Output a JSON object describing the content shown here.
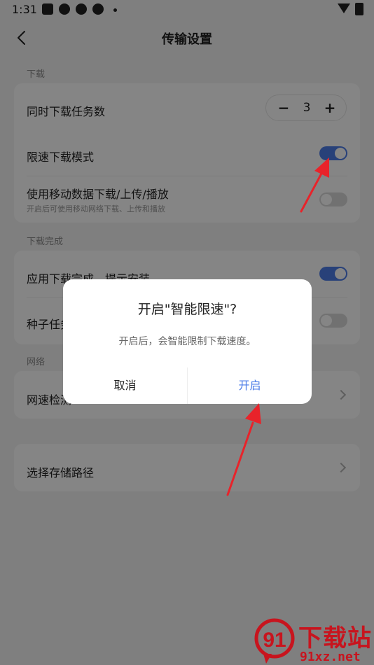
{
  "status_bar": {
    "time": "1:31"
  },
  "header": {
    "title": "传输设置"
  },
  "download_section": {
    "label": "下载",
    "concurrent_label": "同时下载任务数",
    "concurrent_value": "3",
    "minus_label": "−",
    "plus_label": "+",
    "speed_limit_label": "限速下载模式",
    "speed_limit_on": true,
    "mobile_data_label": "使用移动数据下载/上传/播放",
    "mobile_data_sub": "开启后可使用移动网络下载、上传和播放",
    "mobile_data_on": false
  },
  "complete_section": {
    "label": "下载完成",
    "install_label": "应用下载完成，提示安装",
    "install_on": true,
    "seed_label": "种子任务",
    "seed_on": false
  },
  "network_section": {
    "label": "网络",
    "speed_test_label": "网速检测"
  },
  "storage": {
    "path_label": "选择存储路径"
  },
  "dialog": {
    "title": "开启\"智能限速\"?",
    "message": "开启后，会智能限制下载速度。",
    "cancel_label": "取消",
    "confirm_label": "开启"
  },
  "watermark": {
    "brand": "下载站",
    "url": "91xz.net",
    "logo_text": "91"
  },
  "colors": {
    "accent": "#4d7de8",
    "arrow": "#e8232a",
    "watermark": "#c8141e"
  }
}
